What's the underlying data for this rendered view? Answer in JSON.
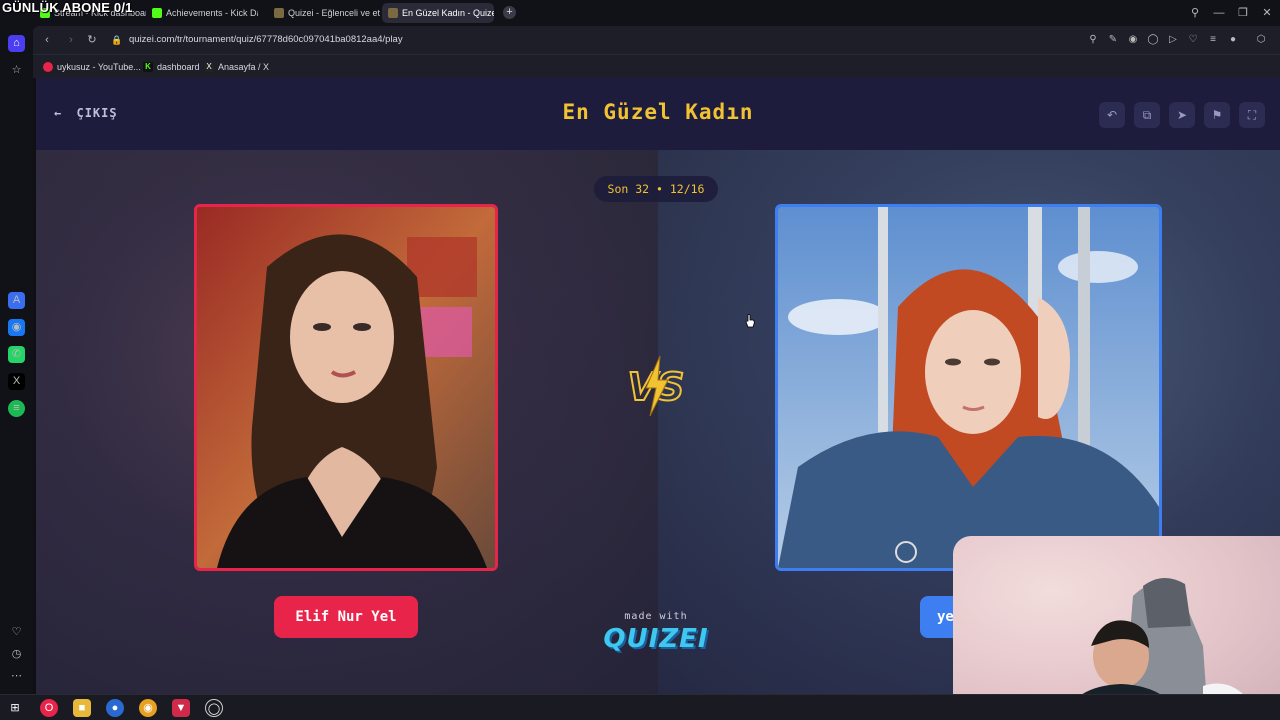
{
  "overlay": {
    "title": "GÜNLÜK ABONE 0/1"
  },
  "browser": {
    "tabs": [
      {
        "label": "Stream - Kick dashboard",
        "color": "#53fc18"
      },
      {
        "label": "Achievements - Kick Dash",
        "color": "#53fc18"
      },
      {
        "label": "Quizei - Eğlenceli ve etkil",
        "color": "#6c5ce7"
      },
      {
        "label": "En Güzel Kadın - Quizei",
        "color": "#6c5ce7"
      }
    ],
    "new_tab_label": "+",
    "url": "quizei.com/tr/tournament/quiz/67778d60c097041ba0812aa4/play",
    "bookmarks": [
      {
        "label": "uykusuz - YouTube...",
        "icon": "youtube-icon",
        "color": "#e8244a"
      },
      {
        "label": "dashboard",
        "icon": "kick-icon",
        "color": "#53fc18"
      },
      {
        "label": "Anasayfa / X",
        "icon": "x-icon",
        "color": "#222222"
      }
    ]
  },
  "header": {
    "exit_label": "ÇIKIŞ",
    "title": "En Güzel Kadın"
  },
  "arena": {
    "round_badge": "Son 32 • 12/16",
    "left": {
      "name": "Elif Nur Yel",
      "accent": "#e8244a"
    },
    "right": {
      "name": "ye",
      "accent": "#3d7ef0"
    },
    "vs_text": "VS",
    "made_with": "made with",
    "brand": "QUIZEI"
  },
  "colors": {
    "title": "#f1c232",
    "page_bg": "#1c1b3a",
    "left_accent": "#e8244a",
    "right_accent": "#3d7ef0"
  }
}
